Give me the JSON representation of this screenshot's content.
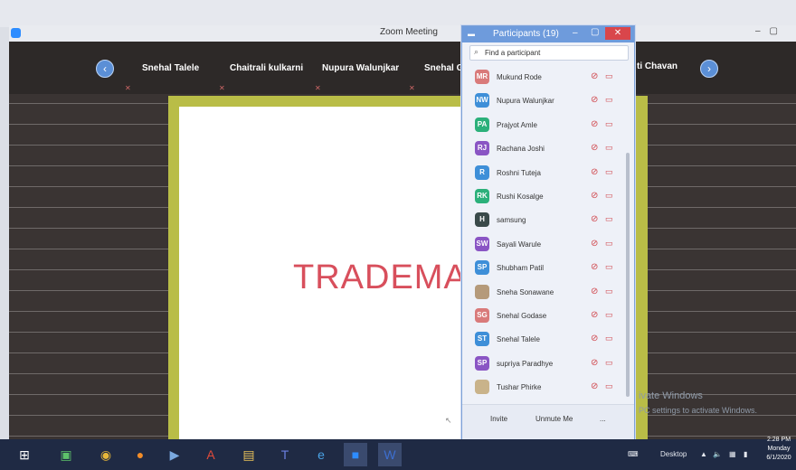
{
  "window": {
    "title": "Zoom Meeting"
  },
  "colors": {
    "accent": "#6e9bdc",
    "mute_red": "#d0474d",
    "slide_text": "#d84f5c",
    "slide_frame": "#b9bd47",
    "taskbar": "#1f2a44"
  },
  "video_strip": {
    "names": [
      "Snehal Talele",
      "Chaitrali kulkarni",
      "Nupura Walunjkar",
      "Snehal G"
    ],
    "right_name": "ti Chavan",
    "prev_icon": "chevron-left-icon",
    "next_icon": "chevron-right-icon"
  },
  "shared_screen": {
    "text": "TRADEMA"
  },
  "participants": {
    "title": "Participants (19)",
    "search_placeholder": "Find a participant",
    "items": [
      {
        "initials": "MR",
        "name": "Mukund Rode",
        "color": "#d97a7a"
      },
      {
        "initials": "NW",
        "name": "Nupura Walunjkar",
        "color": "#3e8fd8"
      },
      {
        "initials": "PA",
        "name": "Prajyot Amle",
        "color": "#2bb07a"
      },
      {
        "initials": "RJ",
        "name": "Rachana Joshi",
        "color": "#8a55c4"
      },
      {
        "initials": "R",
        "name": "Roshni Tuteja",
        "color": "#3e8fd8"
      },
      {
        "initials": "RK",
        "name": "Rushi Kosalge",
        "color": "#2bb07a"
      },
      {
        "initials": "H",
        "name": "samsung",
        "color": "#3a4a4a"
      },
      {
        "initials": "SW",
        "name": "Sayali Warule",
        "color": "#8a55c4"
      },
      {
        "initials": "SP",
        "name": "Shubham Patil",
        "color": "#3e8fd8"
      },
      {
        "initials": "",
        "name": "Sneha Sonawane",
        "color": "#b59a7a"
      },
      {
        "initials": "SG",
        "name": "Snehal Godase",
        "color": "#d97a7a"
      },
      {
        "initials": "ST",
        "name": "Snehal Talele",
        "color": "#3e8fd8"
      },
      {
        "initials": "SP",
        "name": "supriya Paradhye",
        "color": "#8a55c4"
      },
      {
        "initials": "",
        "name": "Tushar Phirke",
        "color": "#c9b38a"
      }
    ],
    "footer": {
      "invite": "Invite",
      "unmute": "Unmute Me",
      "more": "..."
    }
  },
  "watermark": {
    "line1": "ivate Windows",
    "line2": "PC settings to activate Windows."
  },
  "taskbar": {
    "desktop_label": "Desktop",
    "time": "2:28 PM",
    "day": "Monday",
    "date": "6/1/2020"
  }
}
